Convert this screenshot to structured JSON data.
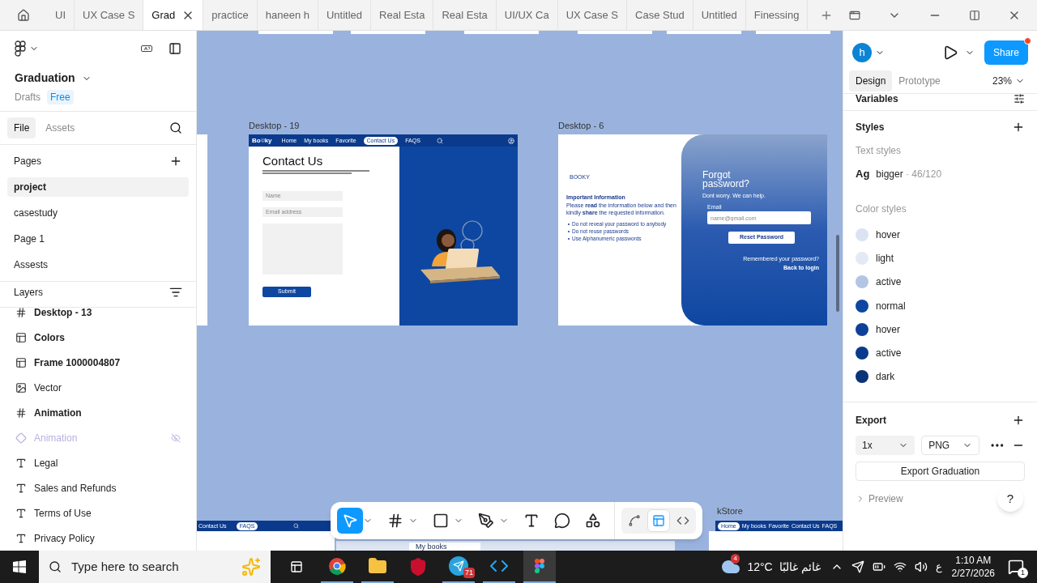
{
  "tabs": [
    {
      "label": "UI",
      "selected": false
    },
    {
      "label": "UX Case S",
      "selected": false
    },
    {
      "label": "Grad",
      "selected": true
    },
    {
      "label": "practice",
      "selected": false
    },
    {
      "label": "haneen h",
      "selected": false
    },
    {
      "label": "Untitled",
      "selected": false
    },
    {
      "label": "Real Esta",
      "selected": false
    },
    {
      "label": "Real Esta",
      "selected": false
    },
    {
      "label": "UI/UX Ca",
      "selected": false
    },
    {
      "label": "UX Case S",
      "selected": false
    },
    {
      "label": "Case Stud",
      "selected": false
    },
    {
      "label": "Untitled",
      "selected": false
    },
    {
      "label": "Finessing",
      "selected": false
    }
  ],
  "file": {
    "name": "Graduation",
    "location": "Drafts",
    "plan": "Free"
  },
  "left_tabs": [
    {
      "label": "File",
      "selected": true
    },
    {
      "label": "Assets",
      "selected": false
    }
  ],
  "pages": {
    "title": "Pages",
    "items": [
      {
        "label": "project",
        "selected": true
      },
      {
        "label": "casestudy",
        "selected": false
      },
      {
        "label": "Page 1",
        "selected": false
      },
      {
        "label": "Assests",
        "selected": false
      }
    ]
  },
  "layers": {
    "title": "Layers",
    "items": [
      {
        "label": "Desktop - 13",
        "kind": "frame",
        "hidden": false
      },
      {
        "label": "Colors",
        "kind": "stack",
        "hidden": false
      },
      {
        "label": "Frame 1000004807",
        "kind": "stack",
        "hidden": false
      },
      {
        "label": "Vector",
        "kind": "vector",
        "hidden": false
      },
      {
        "label": "Animation",
        "kind": "frame",
        "hidden": false
      },
      {
        "label": "Animation",
        "kind": "component",
        "hidden": true
      },
      {
        "label": "Legal",
        "kind": "text",
        "hidden": false
      },
      {
        "label": "Sales and Refunds",
        "kind": "text",
        "hidden": false
      },
      {
        "label": "Terms of Use",
        "kind": "text",
        "hidden": false
      },
      {
        "label": "Privacy Policy",
        "kind": "text",
        "hidden": false
      }
    ]
  },
  "canvas": {
    "contact_frame": {
      "title": "Desktop - 19",
      "logo_start": "Bo",
      "logo_end": "ky",
      "nav": [
        {
          "label": "Home",
          "selected": false
        },
        {
          "label": "My books",
          "selected": false
        },
        {
          "label": "Favorite",
          "selected": false
        },
        {
          "label": "Contact Us",
          "selected": true
        },
        {
          "label": "FAQS",
          "selected": false
        }
      ],
      "heading": "Contact Us",
      "fields": [
        {
          "placeholder": "Name"
        },
        {
          "placeholder": "Email address"
        }
      ],
      "button": "Submit"
    },
    "forgot_frame": {
      "title": "Desktop - 6",
      "logo": "BOOKY",
      "info_title": "Important Information",
      "info_text": "Please **read** the information below and then kindly **share** the requested information.",
      "bullets": [
        "Do not reveal your password to anybody",
        "Do not reuse passwords",
        "Use Alphanumeric passwords"
      ],
      "heading": "Forgot password?",
      "subtitle": "Dont worry. We can help.",
      "email_label": "Email",
      "email_placeholder": "name@gmail.com",
      "button": "Reset Password",
      "remember": "Remembered your password?",
      "back": "Back to login"
    },
    "bottom_left_nav": [
      {
        "label": "Contact Us",
        "selected": false
      },
      {
        "label": "FAQS",
        "selected": true
      }
    ],
    "bottom_middle": "My books",
    "bottom_right_title": "kStore",
    "bottom_right_nav": [
      {
        "label": "Home",
        "selected": true
      },
      {
        "label": "My books",
        "selected": false
      },
      {
        "label": "Favorite",
        "selected": false
      },
      {
        "label": "Contact Us",
        "selected": false
      },
      {
        "label": "FAQS",
        "selected": false
      }
    ]
  },
  "toolbar": [
    {
      "kind": "move",
      "selected": true
    },
    {
      "kind": "frame",
      "selected": false
    },
    {
      "kind": "shape",
      "selected": false
    },
    {
      "kind": "pen",
      "selected": false
    },
    {
      "kind": "text",
      "selected": false
    },
    {
      "kind": "comment",
      "selected": false
    },
    {
      "kind": "actions",
      "selected": false
    }
  ],
  "mode_toggles": [
    {
      "kind": "draw",
      "selected": false
    },
    {
      "kind": "design",
      "selected": true
    },
    {
      "kind": "dev",
      "selected": false
    }
  ],
  "right": {
    "avatar": "h",
    "share": "Share",
    "tabs": [
      {
        "label": "Design",
        "selected": true
      },
      {
        "label": "Prototype",
        "selected": false
      }
    ],
    "zoom": "23%",
    "variables": "Variables",
    "styles": "Styles",
    "text_styles_title": "Text styles",
    "text_style": {
      "sample": "Ag",
      "name": "bigger",
      "meta": " · 46/120"
    },
    "color_styles_title": "Color styles",
    "colors": [
      {
        "name": "hover",
        "color": "#dbe3f3"
      },
      {
        "name": "light",
        "color": "#e4eaf5"
      },
      {
        "name": "active",
        "color": "#b4c5e4"
      },
      {
        "name": "normal",
        "color": "#0d47a1"
      },
      {
        "name": "hover",
        "color": "#0c409a"
      },
      {
        "name": "active",
        "color": "#0b3a8c"
      },
      {
        "name": "dark",
        "color": "#0a337a"
      }
    ],
    "export": {
      "title": "Export",
      "scale": "1x",
      "format": "PNG",
      "button": "Export Graduation",
      "preview": "Preview"
    },
    "help": "?"
  },
  "taskbar": {
    "search_placeholder": "Type here to search",
    "weather_badge": "4",
    "temperature": "12°C",
    "weather": "غائم غالبًا",
    "telegram_badge": "71",
    "language": "ع",
    "time": "1:10 AM",
    "date": "2/27/2026",
    "notifications": "1"
  }
}
